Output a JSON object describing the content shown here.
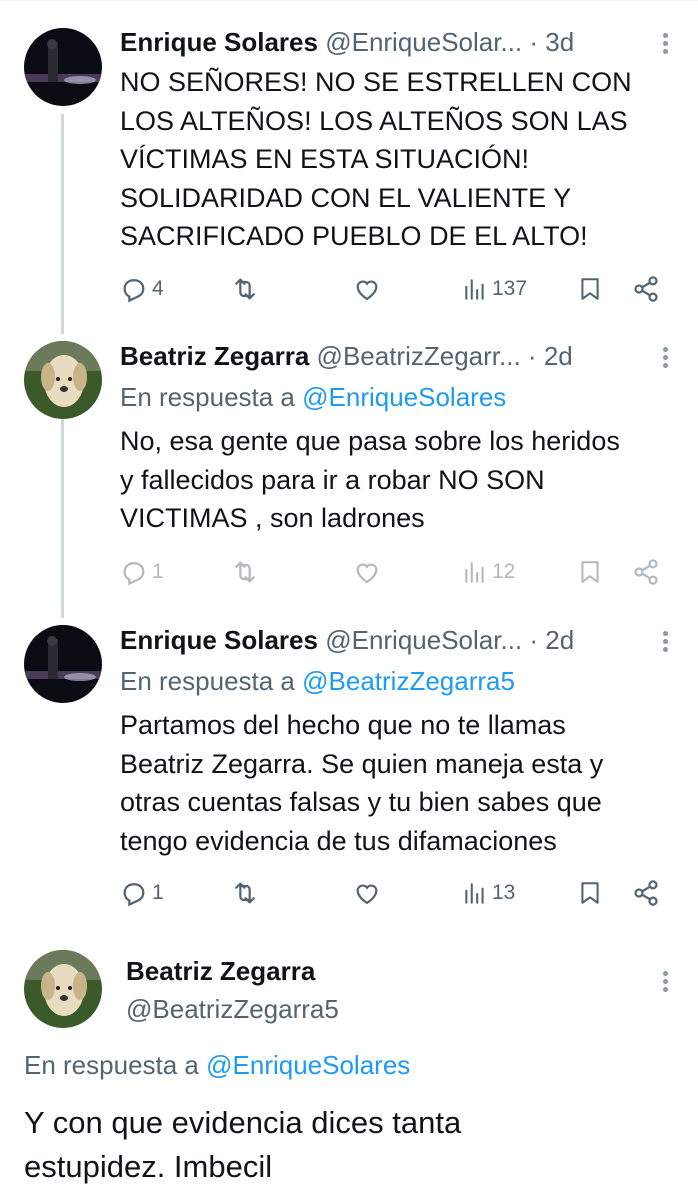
{
  "tweets": [
    {
      "name": "Enrique Solares",
      "handle": "@EnriqueSolar...",
      "dot": "·",
      "time": "3d",
      "text_lines": [
        "NO SEÑORES! NO SE ESTRELLEN CON",
        "LOS ALTEÑOS! LOS ALTEÑOS SON LAS",
        "VÍCTIMAS EN ESTA SITUACIÓN!",
        "SOLIDARIDAD CON EL VALIENTE Y",
        "SACRIFICADO PUEBLO DE EL ALTO!"
      ],
      "replies": "4",
      "retweets": "",
      "likes": "",
      "views": "137"
    },
    {
      "name": "Beatriz Zegarra",
      "handle": "@BeatrizZegarr...",
      "dot": "·",
      "time": "2d",
      "reply_prefix": "En respuesta a",
      "reply_to": "@EnriqueSolares",
      "text_lines": [
        "No, esa gente que pasa sobre los heridos",
        "y fallecidos para ir a robar NO SON",
        "VICTIMAS , son ladrones"
      ],
      "replies": "1",
      "retweets": "",
      "likes": "",
      "views": "12"
    },
    {
      "name": "Enrique Solares",
      "handle": "@EnriqueSolar...",
      "dot": "·",
      "time": "2d",
      "reply_prefix": "En respuesta a",
      "reply_to": "@BeatrizZegarra5",
      "text_lines": [
        "Partamos del hecho que no te llamas",
        "Beatriz Zegarra. Se quien maneja esta y",
        "otras cuentas falsas y tu bien sabes que",
        "tengo evidencia de tus difamaciones"
      ],
      "replies": "1",
      "retweets": "",
      "likes": "",
      "views": "13"
    }
  ],
  "highlighted": {
    "name": "Beatriz Zegarra",
    "handle": "@BeatrizZegarra5",
    "reply_prefix": "En respuesta a",
    "reply_to": "@EnriqueSolares",
    "text_lines": [
      "Y con que evidencia dices tanta",
      "estupidez. Imbecil"
    ]
  },
  "icons": {
    "reply": "reply-icon",
    "retweet": "retweet-icon",
    "like": "like-icon",
    "views": "views-icon",
    "bookmark": "bookmark-icon",
    "share": "share-icon",
    "more": "more-icon"
  },
  "colors": {
    "text": "#0f1419",
    "secondary": "#536471",
    "link": "#1d9bf0",
    "thread_line": "#cfd9de"
  }
}
